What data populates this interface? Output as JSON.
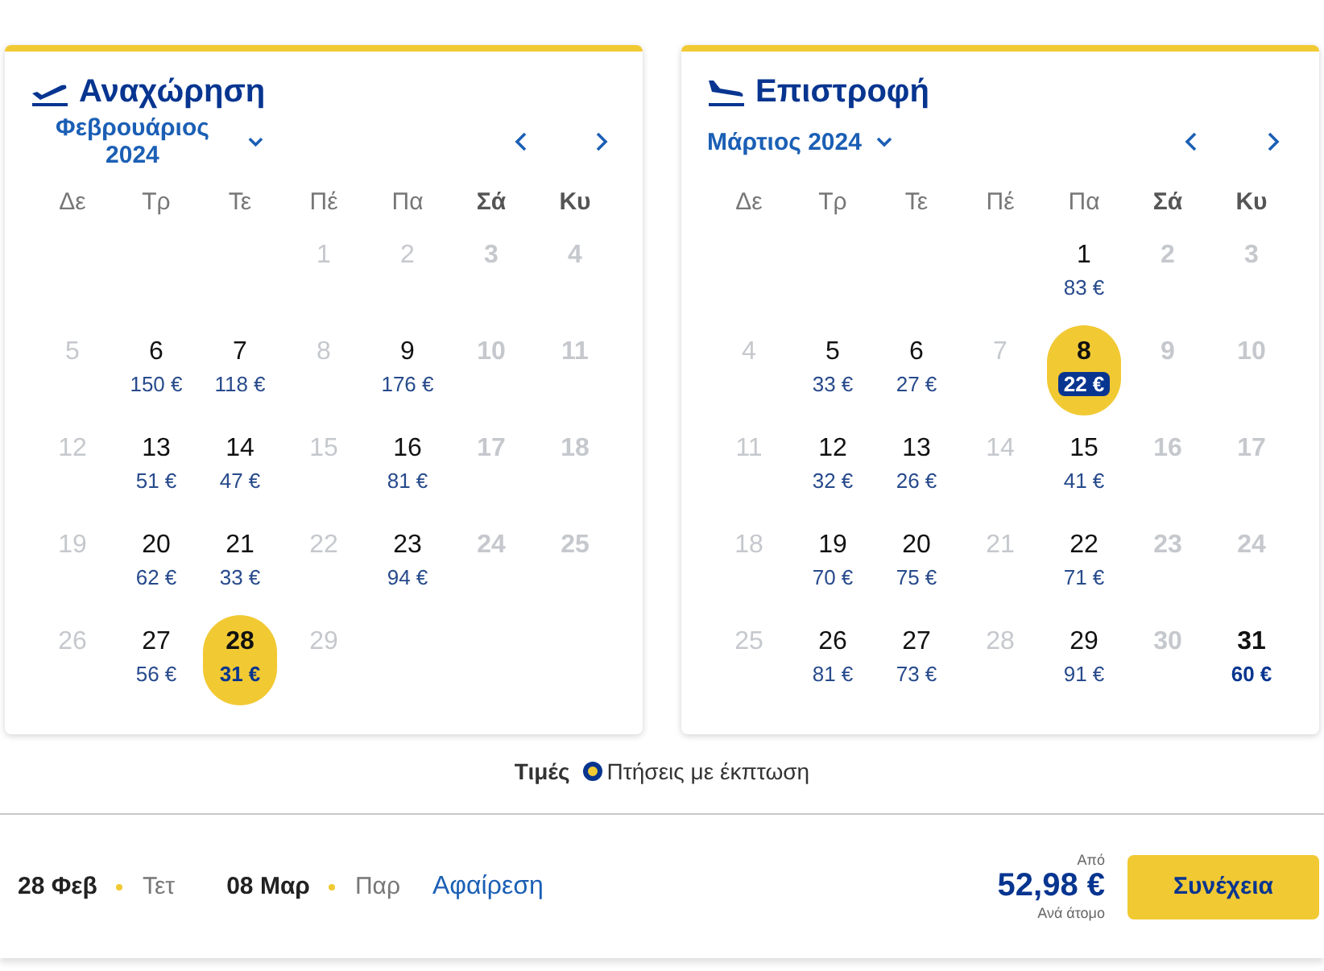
{
  "calendars": [
    {
      "kind": "departure",
      "title": "Αναχώρηση",
      "month": "Φεβρουάριος 2024",
      "weekdays": [
        {
          "label": "Δε",
          "weekend": false
        },
        {
          "label": "Τρ",
          "weekend": false
        },
        {
          "label": "Τε",
          "weekend": false
        },
        {
          "label": "Πέ",
          "weekend": false
        },
        {
          "label": "Πα",
          "weekend": false
        },
        {
          "label": "Σά",
          "weekend": true
        },
        {
          "label": "Κυ",
          "weekend": true
        }
      ],
      "weeks": [
        [
          {
            "kind": "blank"
          },
          {
            "kind": "blank"
          },
          {
            "kind": "blank"
          },
          {
            "kind": "day",
            "day": "1",
            "available": false,
            "selected": false
          },
          {
            "kind": "day",
            "day": "2",
            "available": false,
            "selected": false
          },
          {
            "kind": "day",
            "day": "3",
            "available": false,
            "selected": false
          },
          {
            "kind": "day",
            "day": "4",
            "available": false,
            "selected": false
          }
        ],
        [
          {
            "kind": "day",
            "day": "5",
            "available": false,
            "selected": false
          },
          {
            "kind": "day",
            "day": "6",
            "available": true,
            "selected": false,
            "price": "150 €",
            "discount": false
          },
          {
            "kind": "day",
            "day": "7",
            "available": true,
            "selected": false,
            "price": "118 €",
            "discount": false
          },
          {
            "kind": "day",
            "day": "8",
            "available": false,
            "selected": false
          },
          {
            "kind": "day",
            "day": "9",
            "available": true,
            "selected": false,
            "price": "176 €",
            "discount": false
          },
          {
            "kind": "day",
            "day": "10",
            "available": false,
            "selected": false
          },
          {
            "kind": "day",
            "day": "11",
            "available": false,
            "selected": false
          }
        ],
        [
          {
            "kind": "day",
            "day": "12",
            "available": false,
            "selected": false
          },
          {
            "kind": "day",
            "day": "13",
            "available": true,
            "selected": false,
            "price": "51 €",
            "discount": false
          },
          {
            "kind": "day",
            "day": "14",
            "available": true,
            "selected": false,
            "price": "47 €",
            "discount": false
          },
          {
            "kind": "day",
            "day": "15",
            "available": false,
            "selected": false
          },
          {
            "kind": "day",
            "day": "16",
            "available": true,
            "selected": false,
            "price": "81 €",
            "discount": false
          },
          {
            "kind": "day",
            "day": "17",
            "available": false,
            "selected": false
          },
          {
            "kind": "day",
            "day": "18",
            "available": false,
            "selected": false
          }
        ],
        [
          {
            "kind": "day",
            "day": "19",
            "available": false,
            "selected": false
          },
          {
            "kind": "day",
            "day": "20",
            "available": true,
            "selected": false,
            "price": "62 €",
            "discount": false
          },
          {
            "kind": "day",
            "day": "21",
            "available": true,
            "selected": false,
            "price": "33 €",
            "discount": false
          },
          {
            "kind": "day",
            "day": "22",
            "available": false,
            "selected": false
          },
          {
            "kind": "day",
            "day": "23",
            "available": true,
            "selected": false,
            "price": "94 €",
            "discount": false
          },
          {
            "kind": "day",
            "day": "24",
            "available": false,
            "selected": false
          },
          {
            "kind": "day",
            "day": "25",
            "available": false,
            "selected": false
          }
        ],
        [
          {
            "kind": "day",
            "day": "26",
            "available": false,
            "selected": false
          },
          {
            "kind": "day",
            "day": "27",
            "available": true,
            "selected": false,
            "price": "56 €",
            "discount": false
          },
          {
            "kind": "day",
            "day": "28",
            "available": true,
            "selected": true,
            "price": "31 €",
            "discount": false
          },
          {
            "kind": "day",
            "day": "29",
            "available": false,
            "selected": false
          }
        ]
      ]
    },
    {
      "kind": "return",
      "title": "Επιστροφή",
      "month": "Μάρτιος 2024",
      "weekdays": [
        {
          "label": "Δε",
          "weekend": false
        },
        {
          "label": "Τρ",
          "weekend": false
        },
        {
          "label": "Τε",
          "weekend": false
        },
        {
          "label": "Πέ",
          "weekend": false
        },
        {
          "label": "Πα",
          "weekend": false
        },
        {
          "label": "Σά",
          "weekend": true
        },
        {
          "label": "Κυ",
          "weekend": true
        }
      ],
      "weeks": [
        [
          {
            "kind": "blank"
          },
          {
            "kind": "blank"
          },
          {
            "kind": "blank"
          },
          {
            "kind": "blank"
          },
          {
            "kind": "day",
            "day": "1",
            "available": true,
            "selected": false,
            "price": "83 €",
            "discount": false
          },
          {
            "kind": "day",
            "day": "2",
            "available": false,
            "selected": false
          },
          {
            "kind": "day",
            "day": "3",
            "available": false,
            "selected": false
          }
        ],
        [
          {
            "kind": "day",
            "day": "4",
            "available": false,
            "selected": false
          },
          {
            "kind": "day",
            "day": "5",
            "available": true,
            "selected": false,
            "price": "33 €",
            "discount": false
          },
          {
            "kind": "day",
            "day": "6",
            "available": true,
            "selected": false,
            "price": "27 €",
            "discount": false
          },
          {
            "kind": "day",
            "day": "7",
            "available": false,
            "selected": false
          },
          {
            "kind": "day",
            "day": "8",
            "available": true,
            "selected": true,
            "price": "22 €",
            "discount": true
          },
          {
            "kind": "day",
            "day": "9",
            "available": false,
            "selected": false
          },
          {
            "kind": "day",
            "day": "10",
            "available": false,
            "selected": false
          }
        ],
        [
          {
            "kind": "day",
            "day": "11",
            "available": false,
            "selected": false
          },
          {
            "kind": "day",
            "day": "12",
            "available": true,
            "selected": false,
            "price": "32 €",
            "discount": false
          },
          {
            "kind": "day",
            "day": "13",
            "available": true,
            "selected": false,
            "price": "26 €",
            "discount": false
          },
          {
            "kind": "day",
            "day": "14",
            "available": false,
            "selected": false
          },
          {
            "kind": "day",
            "day": "15",
            "available": true,
            "selected": false,
            "price": "41 €",
            "discount": false
          },
          {
            "kind": "day",
            "day": "16",
            "available": false,
            "selected": false
          },
          {
            "kind": "day",
            "day": "17",
            "available": false,
            "selected": false
          }
        ],
        [
          {
            "kind": "day",
            "day": "18",
            "available": false,
            "selected": false
          },
          {
            "kind": "day",
            "day": "19",
            "available": true,
            "selected": false,
            "price": "70 €",
            "discount": false
          },
          {
            "kind": "day",
            "day": "20",
            "available": true,
            "selected": false,
            "price": "75 €",
            "discount": false
          },
          {
            "kind": "day",
            "day": "21",
            "available": false,
            "selected": false
          },
          {
            "kind": "day",
            "day": "22",
            "available": true,
            "selected": false,
            "price": "71 €",
            "discount": false
          },
          {
            "kind": "day",
            "day": "23",
            "available": false,
            "selected": false
          },
          {
            "kind": "day",
            "day": "24",
            "available": false,
            "selected": false
          }
        ],
        [
          {
            "kind": "day",
            "day": "25",
            "available": false,
            "selected": false
          },
          {
            "kind": "day",
            "day": "26",
            "available": true,
            "selected": false,
            "price": "81 €",
            "discount": false
          },
          {
            "kind": "day",
            "day": "27",
            "available": true,
            "selected": false,
            "price": "73 €",
            "discount": false
          },
          {
            "kind": "day",
            "day": "28",
            "available": false,
            "selected": false
          },
          {
            "kind": "day",
            "day": "29",
            "available": true,
            "selected": false,
            "price": "91 €",
            "discount": false
          },
          {
            "kind": "day",
            "day": "30",
            "available": false,
            "selected": false
          },
          {
            "kind": "day",
            "day": "31",
            "available": true,
            "selected": false,
            "price": "60 €",
            "discount": true
          }
        ]
      ]
    }
  ],
  "legend": {
    "label": "Τιμές",
    "item": "Πτήσεις με έκπτωση"
  },
  "summary": {
    "outbound_date": "28 Φεβ",
    "outbound_day": "Τετ",
    "return_date": "08 Μαρ",
    "return_day": "Παρ",
    "clear_link": "Αφαίρεση",
    "price_prefix": "Από",
    "price": "52,98 €",
    "price_suffix": "Ανά άτομο",
    "continue_button": "Συνέχεια"
  }
}
